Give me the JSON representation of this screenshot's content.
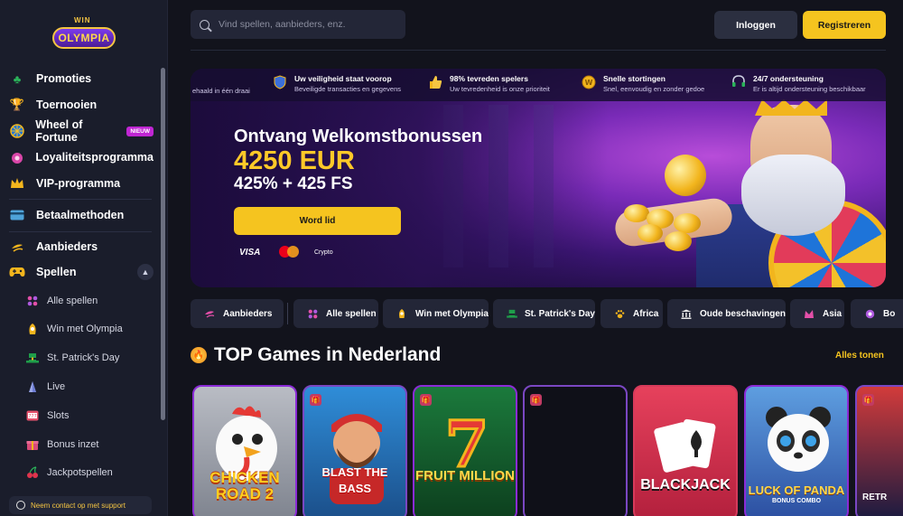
{
  "brand": {
    "win": "WIN",
    "olympia": "OLYMPIA"
  },
  "sidebar": {
    "items": [
      {
        "label": "Promoties",
        "icon": "clover-icon"
      },
      {
        "label": "Toernooien",
        "icon": "trophy-icon"
      },
      {
        "label": "Wheel of Fortune",
        "icon": "wheel-icon",
        "badge": "NIEUW"
      },
      {
        "label": "Loyaliteitsprogramma",
        "icon": "loyalty-icon"
      },
      {
        "label": "VIP-programma",
        "icon": "crown-icon"
      },
      {
        "label": "Betaalmethoden",
        "icon": "card-icon"
      },
      {
        "label": "Aanbieders",
        "icon": "providers-icon"
      },
      {
        "label": "Spellen",
        "icon": "gamepad-icon"
      }
    ],
    "sub_items": [
      {
        "label": "Alle spellen",
        "icon": "grid-icon"
      },
      {
        "label": "Win met Olympia",
        "icon": "olympia-icon"
      },
      {
        "label": "St. Patrick's Day",
        "icon": "leprechaun-hat-icon"
      },
      {
        "label": "Live",
        "icon": "live-icon"
      },
      {
        "label": "Slots",
        "icon": "slots-icon"
      },
      {
        "label": "Bonus inzet",
        "icon": "bonus-icon"
      },
      {
        "label": "Jackpotspellen",
        "icon": "cherry-icon"
      }
    ],
    "support": "Neem contact op met support"
  },
  "header": {
    "search_placeholder": "Vind spellen, aanbieders, enz.",
    "login": "Inloggen",
    "register": "Registreren"
  },
  "banner": {
    "trust_cut": "ehaald in één draai",
    "trust": [
      {
        "title": "Uw veiligheid staat voorop",
        "sub": "Beveiligde transacties en gegevens",
        "icon": "shield-icon"
      },
      {
        "title": "98% tevreden spelers",
        "sub": "Uw tevredenheid is onze prioriteit",
        "icon": "thumbs-up-icon"
      },
      {
        "title": "Snelle stortingen",
        "sub": "Snel, eenvoudig en zonder gedoe",
        "icon": "coin-icon"
      },
      {
        "title": "24/7 ondersteuning",
        "sub": "Er is altijd ondersteuning beschikbaar",
        "icon": "headset-icon"
      }
    ],
    "title": "Ontvang Welkomstbonussen",
    "amount": "4250 EUR",
    "sub": "425% + 425 FS",
    "cta": "Word lid",
    "payments": {
      "visa": "VISA",
      "crypto": "Crypto"
    }
  },
  "categories": [
    {
      "label": "Aanbieders",
      "icon": "providers-icon"
    },
    {
      "label": "Alle spellen",
      "icon": "grid-icon"
    },
    {
      "label": "Win met Olympia",
      "icon": "olympia-icon"
    },
    {
      "label": "St. Patrick's Day",
      "icon": "leprechaun-hat-icon"
    },
    {
      "label": "Africa",
      "icon": "paw-icon"
    },
    {
      "label": "Oude beschavingen",
      "icon": "temple-icon"
    },
    {
      "label": "Asia",
      "icon": "asia-icon"
    },
    {
      "label": "Bo",
      "icon": "bonus-icon"
    }
  ],
  "section": {
    "title": "TOP Games in Nederland",
    "all_link": "Alles tonen"
  },
  "games": [
    {
      "name": "CHICKEN ROAD 2"
    },
    {
      "name": "BLAST THE BASS"
    },
    {
      "name": "FRUIT MILLION"
    },
    {
      "name": ""
    },
    {
      "name": "BLACKJACK"
    },
    {
      "name": "LUCK OF PANDA",
      "sub": "BONUS COMBO"
    },
    {
      "name": "RETR"
    }
  ]
}
